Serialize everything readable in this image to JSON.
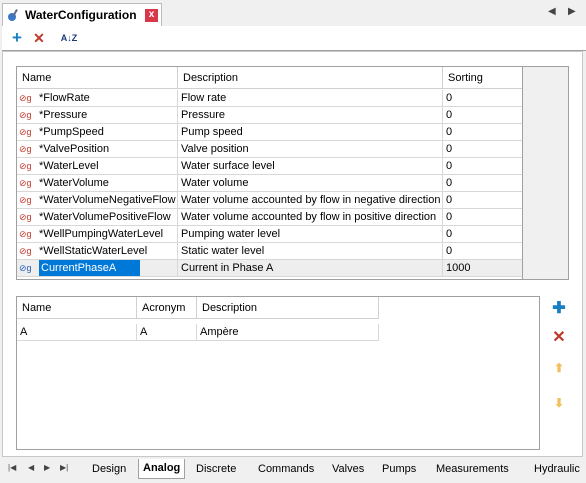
{
  "document_tab": {
    "title": "WaterConfiguration",
    "close": "x"
  },
  "toolbar": {
    "add": "+",
    "delete": "✕",
    "sort": "A↓Z"
  },
  "grid1": {
    "columns": [
      "Name",
      "Description",
      "Sorting"
    ],
    "rows": [
      {
        "name": "*FlowRate",
        "description": "Flow rate",
        "sorting": "0"
      },
      {
        "name": "*Pressure",
        "description": "Pressure",
        "sorting": "0"
      },
      {
        "name": "*PumpSpeed",
        "description": "Pump speed",
        "sorting": "0"
      },
      {
        "name": "*ValvePosition",
        "description": "Valve position",
        "sorting": "0"
      },
      {
        "name": "*WaterLevel",
        "description": "Water surface level",
        "sorting": "0"
      },
      {
        "name": "*WaterVolume",
        "description": "Water volume",
        "sorting": "0"
      },
      {
        "name": "*WaterVolumeNegativeFlow",
        "description": "Water volume accounted by flow in negative direction",
        "sorting": "0"
      },
      {
        "name": "*WaterVolumePositiveFlow",
        "description": "Water volume accounted by flow in positive direction",
        "sorting": "0"
      },
      {
        "name": "*WellPumpingWaterLevel",
        "description": "Pumping water level",
        "sorting": "0"
      },
      {
        "name": "*WellStaticWaterLevel",
        "description": "Static water level",
        "sorting": "0"
      },
      {
        "name": "CurrentPhaseA",
        "description": "Current in Phase A",
        "sorting": "1000"
      }
    ]
  },
  "grid2": {
    "columns": [
      "Name",
      "Acronym",
      "Description"
    ],
    "rows": [
      {
        "name": "A",
        "acronym": "A",
        "description": "Ampère"
      }
    ]
  },
  "bottom_tabs": [
    "Design",
    "Analog",
    "Discrete",
    "Commands",
    "Valves",
    "Pumps",
    "Measurements",
    "Hydraulic"
  ],
  "active_tab": "Analog",
  "colors": {
    "accent": "#0078d7",
    "add": "#1a7fc1",
    "delete": "#c0392b"
  }
}
